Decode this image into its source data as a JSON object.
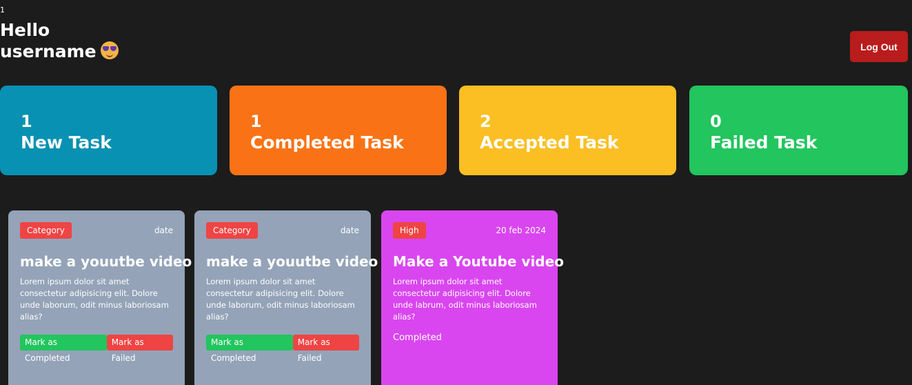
{
  "header": {
    "counter": "1",
    "hello": "Hello",
    "username": "username",
    "emoji_icon": "smiling-face-with-sunglasses-icon",
    "logout_label": "Log Out"
  },
  "stats": [
    {
      "count": "1",
      "label": "New Task",
      "color": "#0891b2"
    },
    {
      "count": "1",
      "label": "Completed Task",
      "color": "#f97316"
    },
    {
      "count": "2",
      "label": "Accepted Task",
      "color": "#fbbf24"
    },
    {
      "count": "0",
      "label": "Failed Task",
      "color": "#22c55e"
    }
  ],
  "tasks": [
    {
      "category": "Category",
      "date": "date",
      "title": "make a youutbe video",
      "description": "Lorem ipsum dolor sit amet consectetur adipisicing elit. Dolore unde laborum, odit minus laboriosam alias?",
      "complete_label": "Mark as Completed",
      "fail_label": "Mark as Failed",
      "color": "#94a3b8"
    },
    {
      "category": "Category",
      "date": "date",
      "title": "make a youutbe video",
      "description": "Lorem ipsum dolor sit amet consectetur adipisicing elit. Dolore unde laborum, odit minus laboriosam alias?",
      "complete_label": "Mark as Completed",
      "fail_label": "Mark as Failed",
      "color": "#94a3b8"
    },
    {
      "category": "High",
      "date": "20 feb 2024",
      "title": "Make a Youtube video",
      "description": "Lorem ipsum dolor sit amet consectetur adipisicing elit. Dolore unde labrum, odit minus laboriosam alias?",
      "status": "Completed",
      "color": "#d946ef"
    }
  ]
}
